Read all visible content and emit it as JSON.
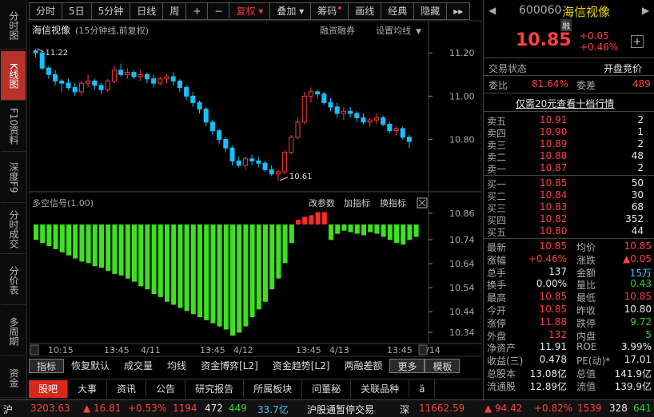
{
  "leftnav": [
    "分时图",
    "K线图",
    "F10资料",
    "深度F9",
    "分时成交",
    "分价表",
    "多周期",
    "资金"
  ],
  "toolbar": {
    "items": [
      "分时",
      "5日",
      "5分钟",
      "日线",
      "周",
      "+",
      "−",
      "复权",
      "叠加",
      "筹码",
      "画线",
      "经典",
      "隐藏",
      "▸▸"
    ]
  },
  "chart": {
    "title": "海信视像",
    "subtitle": "(15分钟线,前复权)",
    "fin": "融资融券",
    "setting": "设置均线",
    "setting_arrow": "▼",
    "high_label": "11.22",
    "low_label": "10.61",
    "price_ticks": [
      "11.20",
      "11.00",
      "10.80"
    ],
    "ind_title": "多空信号(1.00)",
    "ind_btn1": "改参数",
    "ind_btn2": "加指标",
    "ind_btn3": "换指标",
    "ind_ticks": [
      "10.86",
      "10.74",
      "10.64",
      "10.54",
      "10.44",
      "10.34"
    ],
    "time_labels": [
      "10:15",
      "13:45",
      "4/11",
      "13:45",
      "4/12",
      "13:45",
      "4/13",
      "13:45",
      "4/14"
    ]
  },
  "chart_data": {
    "type": "candlestick",
    "candles": [
      [
        11.21,
        11.22,
        11.18,
        11.2
      ],
      [
        11.2,
        11.21,
        11.12,
        11.13
      ],
      [
        11.13,
        11.14,
        11.08,
        11.1
      ],
      [
        11.1,
        11.12,
        11.05,
        11.07
      ],
      [
        11.07,
        11.08,
        11.02,
        11.06
      ],
      [
        11.06,
        11.08,
        11.03,
        11.04
      ],
      [
        11.04,
        11.06,
        11.0,
        11.02
      ],
      [
        11.02,
        11.07,
        11.0,
        11.06
      ],
      [
        11.06,
        11.1,
        11.04,
        11.07
      ],
      [
        11.07,
        11.08,
        11.03,
        11.05
      ],
      [
        11.05,
        11.06,
        11.01,
        11.03
      ],
      [
        11.03,
        11.08,
        11.02,
        11.07
      ],
      [
        11.07,
        11.14,
        11.06,
        11.12
      ],
      [
        11.12,
        11.15,
        11.09,
        11.1
      ],
      [
        11.1,
        11.13,
        11.08,
        11.11
      ],
      [
        11.11,
        11.12,
        11.08,
        11.09
      ],
      [
        11.09,
        11.12,
        11.07,
        11.1
      ],
      [
        11.1,
        11.11,
        11.06,
        11.08
      ],
      [
        11.08,
        11.1,
        11.04,
        11.06
      ],
      [
        11.06,
        11.09,
        11.05,
        11.08
      ],
      [
        11.08,
        11.1,
        11.06,
        11.09
      ],
      [
        11.09,
        11.11,
        11.05,
        11.07
      ],
      [
        11.07,
        11.08,
        11.02,
        11.04
      ],
      [
        11.04,
        11.05,
        10.98,
        11.0
      ],
      [
        11.0,
        11.02,
        10.95,
        10.97
      ],
      [
        10.97,
        10.98,
        10.92,
        10.94
      ],
      [
        10.94,
        10.95,
        10.86,
        10.88
      ],
      [
        10.88,
        10.89,
        10.82,
        10.84
      ],
      [
        10.84,
        10.85,
        10.78,
        10.8
      ],
      [
        10.8,
        10.81,
        10.74,
        10.76
      ],
      [
        10.76,
        10.77,
        10.68,
        10.7
      ],
      [
        10.7,
        10.72,
        10.67,
        10.68
      ],
      [
        10.68,
        10.72,
        10.66,
        10.71
      ],
      [
        10.71,
        10.73,
        10.68,
        10.7
      ],
      [
        10.7,
        10.72,
        10.67,
        10.69
      ],
      [
        10.69,
        10.7,
        10.65,
        10.66
      ],
      [
        10.66,
        10.68,
        10.63,
        10.64
      ],
      [
        10.64,
        10.66,
        10.61,
        10.65
      ],
      [
        10.65,
        10.75,
        10.64,
        10.74
      ],
      [
        10.74,
        10.82,
        10.73,
        10.81
      ],
      [
        10.81,
        10.9,
        10.8,
        10.88
      ],
      [
        10.88,
        11.02,
        10.87,
        11.0
      ],
      [
        11.0,
        11.04,
        10.97,
        11.02
      ],
      [
        11.02,
        11.03,
        10.99,
        11.01
      ],
      [
        11.01,
        11.02,
        10.96,
        10.97
      ],
      [
        10.97,
        10.99,
        10.93,
        10.95
      ],
      [
        10.95,
        10.97,
        10.9,
        10.92
      ],
      [
        10.92,
        10.95,
        10.89,
        10.93
      ],
      [
        10.93,
        10.95,
        10.9,
        10.92
      ],
      [
        10.92,
        10.93,
        10.88,
        10.9
      ],
      [
        10.9,
        10.92,
        10.87,
        10.88
      ],
      [
        10.88,
        10.9,
        10.86,
        10.89
      ],
      [
        10.89,
        10.92,
        10.87,
        10.9
      ],
      [
        10.9,
        10.91,
        10.86,
        10.87
      ],
      [
        10.87,
        10.88,
        10.83,
        10.84
      ],
      [
        10.84,
        10.86,
        10.82,
        10.85
      ],
      [
        10.85,
        10.86,
        10.8,
        10.81
      ],
      [
        10.81,
        10.82,
        10.76,
        10.79
      ]
    ],
    "signal": [
      -0.1,
      -0.12,
      -0.14,
      -0.16,
      -0.18,
      -0.2,
      -0.22,
      -0.24,
      -0.25,
      -0.27,
      -0.28,
      -0.3,
      -0.32,
      -0.33,
      -0.35,
      -0.37,
      -0.4,
      -0.42,
      -0.45,
      -0.47,
      -0.5,
      -0.52,
      -0.54,
      -0.56,
      -0.58,
      -0.6,
      -0.62,
      -0.64,
      -0.66,
      -0.68,
      -0.72,
      -0.7,
      -0.66,
      -0.6,
      -0.55,
      -0.5,
      -0.42,
      -0.35,
      -0.25,
      -0.12,
      0.03,
      0.05,
      0.06,
      0.08,
      0.08,
      -0.1,
      -0.06,
      -0.04,
      -0.05,
      -0.06,
      -0.07,
      -0.05,
      -0.06,
      -0.08,
      -0.1,
      -0.12,
      -0.13,
      -0.1,
      -0.08
    ]
  },
  "quote": {
    "code": "600060",
    "name": "海信视像",
    "badge": "融",
    "price": "10.85",
    "chg": "+0.05",
    "pct": "+0.46%",
    "state_label": "交易状态",
    "state_val": "开盘竞价",
    "wb_label": "委比",
    "wb_val": "81.64%",
    "wc_label": "委差",
    "wc_val": "489",
    "link": "仅需20元查看十档行情"
  },
  "asks": [
    [
      "卖五",
      "10.91",
      "2"
    ],
    [
      "卖四",
      "10.90",
      "1"
    ],
    [
      "卖三",
      "10.89",
      "2"
    ],
    [
      "卖二",
      "10.88",
      "48"
    ],
    [
      "卖一",
      "10.87",
      "2"
    ]
  ],
  "bids": [
    [
      "买一",
      "10.85",
      "50"
    ],
    [
      "买二",
      "10.84",
      "30"
    ],
    [
      "买三",
      "10.83",
      "68"
    ],
    [
      "买四",
      "10.82",
      "352"
    ],
    [
      "买五",
      "10.80",
      "44"
    ]
  ],
  "stats": [
    [
      "最新",
      "10.85",
      "均价",
      "10.85"
    ],
    [
      "涨幅",
      "+0.46%",
      "涨跌",
      "▲0.05"
    ],
    [
      "总手",
      "137",
      "金额",
      "15万"
    ],
    [
      "换手",
      "0.00%",
      "量比",
      "0.43"
    ],
    [
      "最高",
      "10.85",
      "最低",
      "10.85"
    ],
    [
      "今开",
      "10.85",
      "昨收",
      "10.80"
    ],
    [
      "涨停",
      "11.88",
      "跌停",
      "9.72"
    ],
    [
      "外盘",
      "132",
      "内盘",
      "5"
    ],
    [
      "净资产",
      "11.91",
      "ROE",
      "3.99%"
    ],
    [
      "收益(三)",
      "0.478",
      "PE(动)*",
      "17.01"
    ],
    [
      "总股本",
      "13.08亿",
      "总值",
      "141.9亿"
    ],
    [
      "流通股",
      "12.89亿",
      "流值",
      "139.9亿"
    ]
  ],
  "tabs": [
    "指标",
    "恢复默认",
    "成交量",
    "均线",
    "资金博弈[L2]",
    "资金趋势[L2]",
    "两融差额",
    "更多",
    "模板"
  ],
  "tabs2": [
    "股吧",
    "大事",
    "资讯",
    "公告",
    "研究报告",
    "所属板块",
    "问董秘",
    "关联品种",
    "ä"
  ],
  "status": {
    "sh": "沪",
    "sh_idx": "3203.63",
    "sh_chg": "▲ 16.81",
    "sh_pct": "+0.53%",
    "sh_amt": "1194",
    "sh_up": "472",
    "sh_dn": "449",
    "sh_vol": "33.7亿",
    "msg": "沪股通暂停交易",
    "sz": "深",
    "sz_idx": "11662.59",
    "sz_chg": "▲ 94.42",
    "sz_pct": "+0.82%",
    "sz_amt": "1539",
    "sz_up": "328",
    "sz_dn": "641"
  }
}
